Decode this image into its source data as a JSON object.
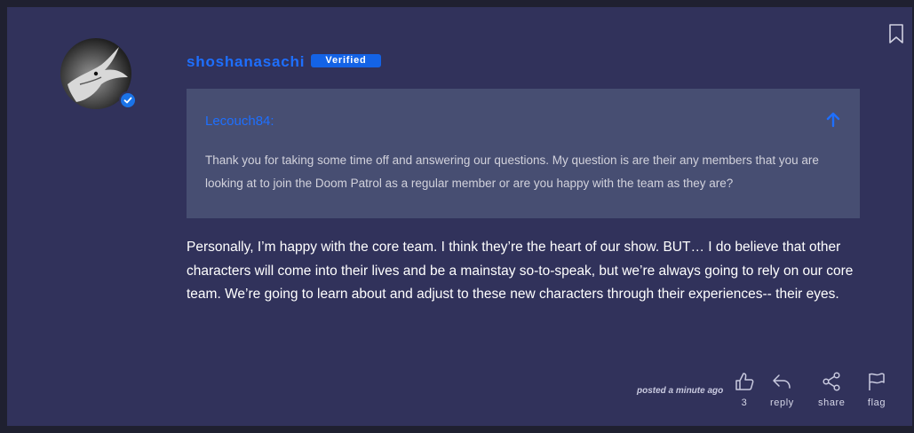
{
  "post": {
    "username": "shoshanasachi",
    "badge": "Verified",
    "quote": {
      "author": "Lecouch84:",
      "text": "Thank you for taking some time off and answering our questions. My question is are their any members that you are looking at to join the Doom Patrol as a regular member or are you happy with the team as they are?"
    },
    "body": "Personally, I’m happy with the core team. I think they’re the heart of our show. BUT… I do believe that other characters will come into their lives and be a mainstay so-to-speak, but we’re always going to rely on our core team. We’re going to learn about and adjust to these new characters through their experiences-- their eyes.",
    "posted_time": "posted a minute ago"
  },
  "actions": {
    "like_count": "3",
    "reply_label": "reply",
    "share_label": "share",
    "flag_label": "flag"
  },
  "icons": {
    "bookmark": "bookmark-icon",
    "verified_check": "check-icon",
    "quote_arrow": "arrow-up-icon",
    "like": "thumbs-up-icon",
    "reply": "reply-arrow-icon",
    "share": "share-icon",
    "flag": "flag-icon"
  },
  "colors": {
    "card_bg": "#31325b",
    "quote_bg": "#474e72",
    "accent": "#1e6fff",
    "badge_bg": "#1463e6"
  }
}
